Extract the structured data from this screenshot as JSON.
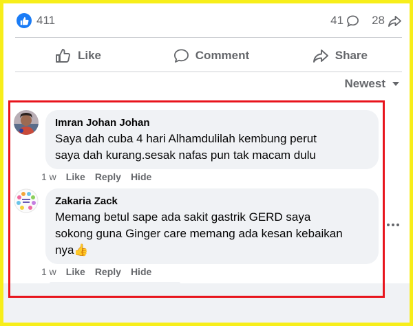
{
  "stats": {
    "likes": "411",
    "comments": "41",
    "shares": "28"
  },
  "actions": {
    "like": "Like",
    "comment": "Comment",
    "share": "Share"
  },
  "sort": {
    "label": "Newest"
  },
  "comments": [
    {
      "author": "Imran Johan Johan",
      "lines": [
        "Saya dah cuba 4 hari Alhamdulilah kembung perut",
        "saya dah kurang.sesak nafas pun tak macam dulu"
      ],
      "time": "1 w",
      "like": "Like",
      "reply": "Reply",
      "hide": "Hide"
    },
    {
      "author": "Zakaria Zack",
      "lines": [
        "Memang betul sape ada sakit gastrik GERD saya",
        "sokong guna Ginger care memang ada kesan kebaikan",
        "nya"
      ],
      "emoji": "👍",
      "time": "1 w",
      "like": "Like",
      "reply": "Reply",
      "hide": "Hide"
    }
  ],
  "colors": {
    "accent": "#1a7cf6",
    "frame_yellow": "#f7ee1a",
    "frame_red": "#e8141c",
    "bubble": "#f0f2f5",
    "muted": "#65676b"
  },
  "icons": [
    "like-badge-icon",
    "comment-count-icon",
    "share-count-icon",
    "thumbs-up-icon",
    "comment-icon",
    "share-icon",
    "caret-down-icon",
    "more-options-icon"
  ]
}
